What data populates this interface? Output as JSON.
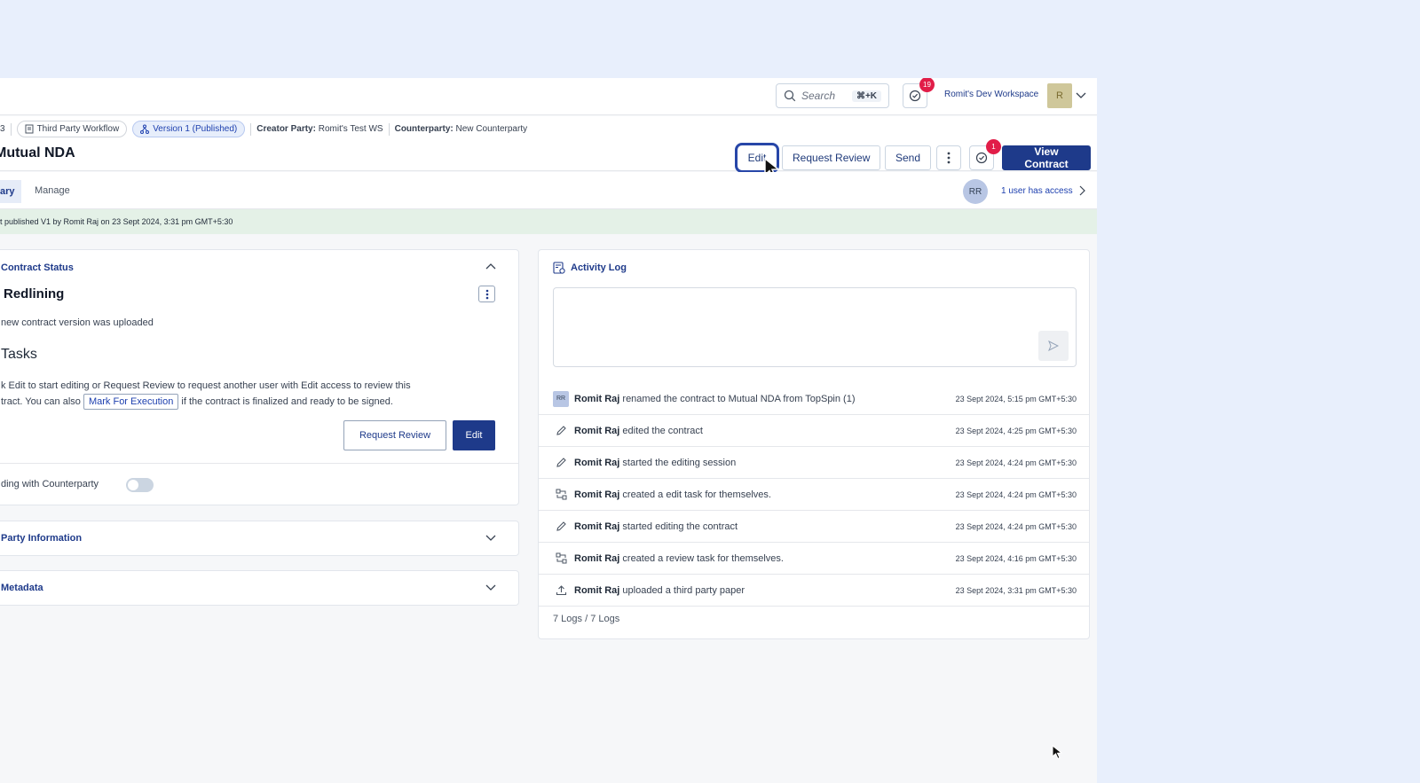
{
  "topbar": {
    "search_placeholder": "Search",
    "search_shortcut": "⌘+K",
    "tasks_badge": "19",
    "workspace_name": "Romit's Dev Workspace",
    "avatar_initial": "R"
  },
  "header": {
    "id_fragment": "3",
    "workflow_chip": "Third Party Workflow",
    "version_chip": "Version 1 (Published)",
    "creator_label": "Creator Party:",
    "creator_value": "Romit's Test WS",
    "counterparty_label": "Counterparty:",
    "counterparty_value": "New Counterparty",
    "title": "Mutual NDA",
    "buttons": {
      "edit": "Edit",
      "request_review": "Request Review",
      "send": "Send",
      "view_contract": "View Contract"
    },
    "tasks_badge": "1"
  },
  "tabs": {
    "active_fragment": "ary",
    "manage": "Manage",
    "user_initials": "RR",
    "access_text": "1 user has access"
  },
  "banner": {
    "text": "t published V1 by Romit Raj on 23 Sept 2024, 3:31 pm GMT+5:30"
  },
  "contract_status": {
    "section_title": "Contract Status",
    "status": "Redlining",
    "description": "new contract version was uploaded",
    "tasks_heading": "Tasks",
    "tasks_text_1": "k Edit to start editing or Request Review to request another user with Edit access to review this",
    "tasks_text_2a": "tract. You can also",
    "mark_for_execution": "Mark For Execution",
    "tasks_text_2b": "if the contract is finalized and ready to be signed.",
    "request_review_button": "Request Review",
    "edit_button": "Edit",
    "counterparty_toggle_label": "ding with Counterparty"
  },
  "party_information": {
    "title": "Party Information"
  },
  "metadata": {
    "title": "Metadata"
  },
  "activity_log": {
    "title": "Activity Log",
    "entries": [
      {
        "user": "Romit Raj",
        "action": "renamed the contract to Mutual NDA from TopSpin (1)",
        "time": "23 Sept 2024, 5:15 pm GMT+5:30",
        "icon": "avatar-rr"
      },
      {
        "user": "Romit Raj",
        "action": "edited the contract",
        "time": "23 Sept 2024, 4:25 pm GMT+5:30",
        "icon": "pencil-icon"
      },
      {
        "user": "Romit Raj",
        "action": "started the editing session",
        "time": "23 Sept 2024, 4:24 pm GMT+5:30",
        "icon": "pencil-icon"
      },
      {
        "user": "Romit Raj",
        "action": "created a edit task for themselves.",
        "time": "23 Sept 2024, 4:24 pm GMT+5:30",
        "icon": "task-icon"
      },
      {
        "user": "Romit Raj",
        "action": "started editing the contract",
        "time": "23 Sept 2024, 4:24 pm GMT+5:30",
        "icon": "pencil-icon"
      },
      {
        "user": "Romit Raj",
        "action": "created a review task for themselves.",
        "time": "23 Sept 2024, 4:16 pm GMT+5:30",
        "icon": "task-icon"
      },
      {
        "user": "Romit Raj",
        "action": "uploaded a third party paper",
        "time": "23 Sept 2024, 3:31 pm GMT+5:30",
        "icon": "upload-icon"
      }
    ],
    "log_count": "7 Logs / 7 Logs"
  },
  "colors": {
    "primary": "#1e3a8a",
    "background": "#e8effc",
    "banner": "#e4f1e7",
    "badge": "#e11d48"
  }
}
